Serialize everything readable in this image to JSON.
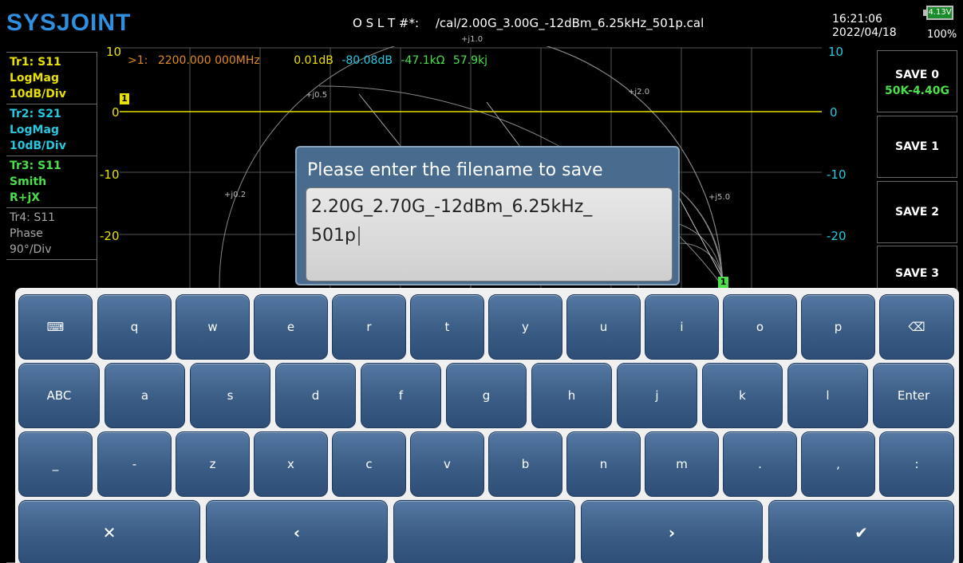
{
  "header": {
    "logo": "SYSJOINT",
    "cal_label": "O S L T #*:",
    "cal_file": "/cal/2.00G_3.00G_-12dBm_6.25kHz_501p.cal",
    "time": "16:21:06",
    "date": "2022/04/18",
    "battery_voltage": "4.13V",
    "battery_percent": "100%"
  },
  "traces": [
    {
      "line1": "Tr1:  S11",
      "line2": "LogMag",
      "line3": "10dB/Div"
    },
    {
      "line1": "Tr2:  S21",
      "line2": "LogMag",
      "line3": "10dB/Div"
    },
    {
      "line1": "Tr3:  S11",
      "line2": "Smith",
      "line3": "R+jX"
    },
    {
      "line1": "Tr4:  S11",
      "line2": "Phase",
      "line3": "90°/Div"
    }
  ],
  "graph": {
    "y_left": [
      "10",
      "0",
      "-10",
      "-20"
    ],
    "y_right": [
      "10",
      "0",
      "-10",
      "-20"
    ],
    "marker": {
      "id": ">1:",
      "freq": "2200.000 000MHz",
      "val1": "0.01dB",
      "val2": "-80.08dB",
      "val3": "-47.1kΩ",
      "val4": "57.9kj"
    },
    "smith_labels": [
      "+j1.0",
      "+j0.5",
      "+j2.0",
      "+j0.2",
      "+j5.0"
    ],
    "marker_flag": "1"
  },
  "softkeys": [
    {
      "label": "SAVE 0",
      "sub": "50K-4.40G"
    },
    {
      "label": "SAVE 1",
      "sub": ""
    },
    {
      "label": "SAVE 2",
      "sub": ""
    },
    {
      "label": "SAVE 3",
      "sub": ""
    }
  ],
  "dialog": {
    "title": "Please enter the filename to save",
    "line1": "2.20G_2.70G_-12dBm_6.25kHz_",
    "line2": "501p"
  },
  "keyboard": {
    "row1": [
      "⌨",
      "q",
      "w",
      "e",
      "r",
      "t",
      "y",
      "u",
      "i",
      "o",
      "p",
      "⌫"
    ],
    "row2": [
      "ABC",
      "a",
      "s",
      "d",
      "f",
      "g",
      "h",
      "j",
      "k",
      "l",
      "Enter"
    ],
    "row3": [
      "_",
      "-",
      "z",
      "x",
      "c",
      "v",
      "b",
      "n",
      "m",
      ".",
      ",",
      ":"
    ],
    "row4": [
      "✕",
      "‹",
      "",
      "›",
      "✔"
    ]
  },
  "colors": {
    "trace1": "#e8e000",
    "trace2": "#26c8e0",
    "trace3": "#4ae04a",
    "key_blue": "#3a5c85",
    "dialog_bg": "#496b8e"
  }
}
